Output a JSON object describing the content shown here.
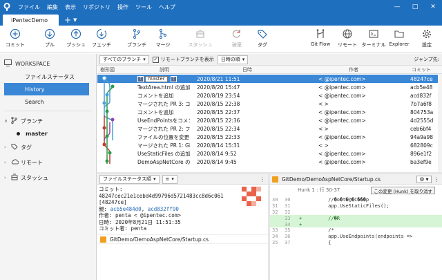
{
  "app": {
    "menu": [
      "ファイル",
      "編集",
      "表示",
      "リポジトリ",
      "操作",
      "ツール",
      "ヘルプ"
    ],
    "tab_title": "iPentecDemo"
  },
  "toolbar": {
    "commit": "コミット",
    "pull": "プル",
    "push": "プッシュ",
    "fetch": "フェッチ",
    "branch": "ブランチ",
    "merge": "マージ",
    "stash": "スタッシュ",
    "discard": "破棄",
    "tag": "タグ",
    "gitflow": "Git Flow",
    "remote": "リモート",
    "terminal": "ターミナル",
    "explorer": "Explorer",
    "settings": "設定"
  },
  "sidebar": {
    "workspace": "WORKSPACE",
    "items": [
      "ファイルステータス",
      "History",
      "Search"
    ],
    "selected": "History",
    "branches_label": "ブランチ",
    "branches": [
      "master"
    ],
    "tags_label": "タグ",
    "remotes_label": "リモート",
    "stash_label": "スタッシュ"
  },
  "filter": {
    "branches_dropdown": "すべてのブランチ",
    "show_remote_label": "リモートブランチを表示",
    "show_remote_checked": true,
    "order_dropdown": "日時の順",
    "jump": "ジャンプ先:"
  },
  "table": {
    "headers": {
      "graph": "樹形図",
      "desc": "説明",
      "date": "日時",
      "author": "作者",
      "commit": "コミット"
    },
    "rows": [
      {
        "desc": "master",
        "date": "2020/8/21 11:51",
        "author": "<      @ipentec.com>",
        "commit": "48247ce",
        "selected": true,
        "branch_tag": "master"
      },
      {
        "desc": "TextArea.html の追加",
        "date": "2020/8/20 15:47",
        "author": "<      @ipentec.com>",
        "commit": "acb5e48"
      },
      {
        "desc": "コメントを追加",
        "date": "2020/8/19 23:54",
        "author": "<      @ipentec.com>",
        "commit": "acd832f"
      },
      {
        "desc": "マージされた PR 3: コメント",
        "date": "2020/8/15 22:38",
        "author": "<      >",
        "commit": "7b7a6f8"
      },
      {
        "desc": "コメントを追加",
        "date": "2020/8/15 22:37",
        "author": "<      @ipentec.com>",
        "commit": "804753a"
      },
      {
        "desc": "UseEndPointsをコメント",
        "date": "2020/8/15 22:36",
        "author": "<      @ipentec.com>",
        "commit": "4d2555d"
      },
      {
        "desc": "マージされた PR 2: ファイル",
        "date": "2020/8/15 22:34",
        "author": "<      >",
        "commit": "ceb6bf4"
      },
      {
        "desc": "ファイルの位置を変更",
        "date": "2020/8/15 22:33",
        "author": "<      @ipentec.com>",
        "commit": "94a9a98"
      },
      {
        "desc": "マージされた PR 1: GitDe",
        "date": "2020/8/14 15:31",
        "author": "<      >",
        "commit": "682809c"
      },
      {
        "desc": "UseStaticFiles の追加",
        "date": "2020/8/14 9:52",
        "author": "<      @ipentec.com>",
        "commit": "896e1f2"
      },
      {
        "desc": "DemoAspNetCore の追加",
        "date": "2020/8/14 9:45",
        "author": "<      @ipentec.com>",
        "commit": "ba3ef9e"
      }
    ]
  },
  "left_panel": {
    "status_dropdown": "ファイルステータス順",
    "view_dropdown": "≡",
    "commit_label": "コミット:",
    "commit_hash": "48247cec21e1cebd4d99796d5721483cc8d6c061",
    "commit_short": "[48247ce]",
    "parents_label": "親:",
    "parent1": "acb5e484d0",
    "parent2": "acd832ff90",
    "author_line": "作者: penta <      @ipentec.com>",
    "date_line": "日時: 2020年8月21日 11:51:35",
    "committer_line": "コミット者: penta",
    "file": "GitDemo/DemoAspNetCore/Startup.cs"
  },
  "right_panel": {
    "file": "GitDemo/DemoAspNetCore/Startup.cs",
    "hunk": "Hunk 1 : 行 30-37",
    "hunk_button": "この変更 (Hunk) を取り消す",
    "lines": [
      {
        "n1": "30",
        "n2": "30",
        "code": "          //�o�t�@�C���p",
        "type": "ctx"
      },
      {
        "n1": "31",
        "n2": "31",
        "code": "          app.UseStaticFiles();",
        "type": "ctx"
      },
      {
        "n1": "32",
        "n2": "32",
        "code": "",
        "type": "ctx"
      },
      {
        "n1": "",
        "n2": "33",
        "code": "+         //�R",
        "type": "add"
      },
      {
        "n1": "",
        "n2": "34",
        "code": "+",
        "type": "add"
      },
      {
        "n1": "33",
        "n2": "35",
        "code": "          /*",
        "type": "ctx"
      },
      {
        "n1": "34",
        "n2": "36",
        "code": "          app.UseEndpoints(endpoints =>",
        "type": "ctx"
      },
      {
        "n1": "35",
        "n2": "37",
        "code": "          {",
        "type": "ctx"
      }
    ]
  },
  "colors": {
    "accent": "#1f6fbf",
    "selection": "#3a87d6"
  }
}
